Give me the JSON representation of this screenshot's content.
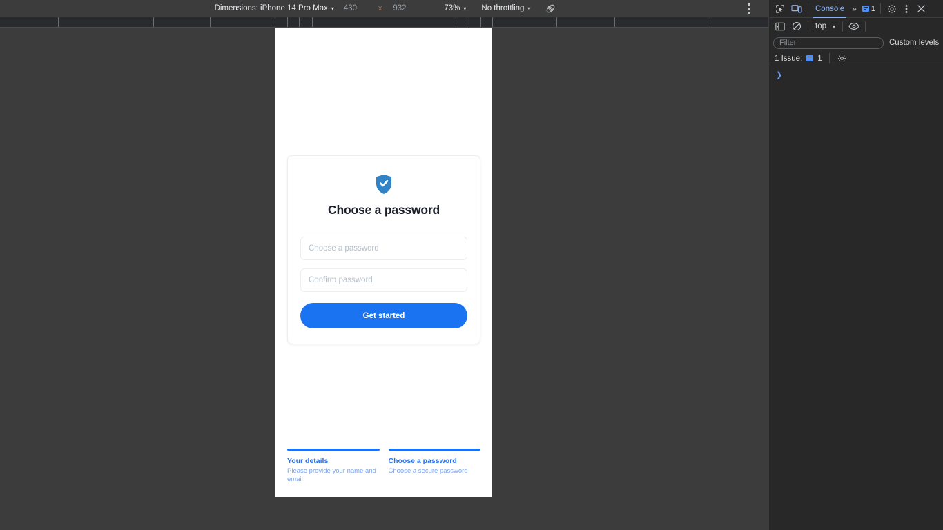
{
  "device_toolbar": {
    "dimensions_label": "Dimensions: iPhone 14 Pro Max",
    "width_value": "430",
    "times_symbol": "x",
    "height_value": "932",
    "zoom_value": "73%",
    "throttling_value": "No throttling",
    "rotate_icon": "rotate-device-icon",
    "more_icon": "more-options-icon",
    "caret": "▾"
  },
  "page": {
    "card": {
      "icon": "shield-check-icon",
      "title": "Choose a password",
      "fields": [
        {
          "name": "password",
          "placeholder": "Choose a password",
          "value": ""
        },
        {
          "name": "confirm-password",
          "placeholder": "Confirm password",
          "value": ""
        }
      ],
      "submit_label": "Get started"
    },
    "stepper": [
      {
        "title": "Your details",
        "desc": "Please provide your name and email",
        "state": "complete"
      },
      {
        "title": "Choose a password",
        "desc": "Choose a secure password",
        "state": "active"
      }
    ]
  },
  "devtools": {
    "tabbar": {
      "inspect_icon": "inspect-element-icon",
      "device_toggle_icon": "device-toolbar-icon",
      "active_tab": "Console",
      "overflow_label": "»",
      "issues_icon": "issues-flag-icon",
      "issues_count": "1",
      "settings_icon": "gear-icon",
      "more_icon": "more-options-icon",
      "close_icon": "close-icon"
    },
    "subbar": {
      "sidebar_icon": "console-sidebar-icon",
      "clear_icon": "clear-console-icon",
      "context": "top",
      "eye_icon": "live-expression-icon",
      "caret": "▾"
    },
    "filterbar": {
      "filter_placeholder": "Filter",
      "filter_value": "",
      "levels_label": "Custom levels",
      "caret": "▾"
    },
    "issuebar": {
      "label": "1 Issue:",
      "count": "1",
      "icon": "issues-flag-icon",
      "settings_icon": "gear-icon"
    },
    "console": {
      "prompt": "❯"
    }
  },
  "colors": {
    "accent_blue": "#1a73f0",
    "link_blue": "#2b71e8",
    "shield_blue": "#3183c8",
    "devtools_bg": "#282828",
    "toolbar_bg": "#3c3c3c",
    "devtools_accent": "#8ab4f8"
  }
}
